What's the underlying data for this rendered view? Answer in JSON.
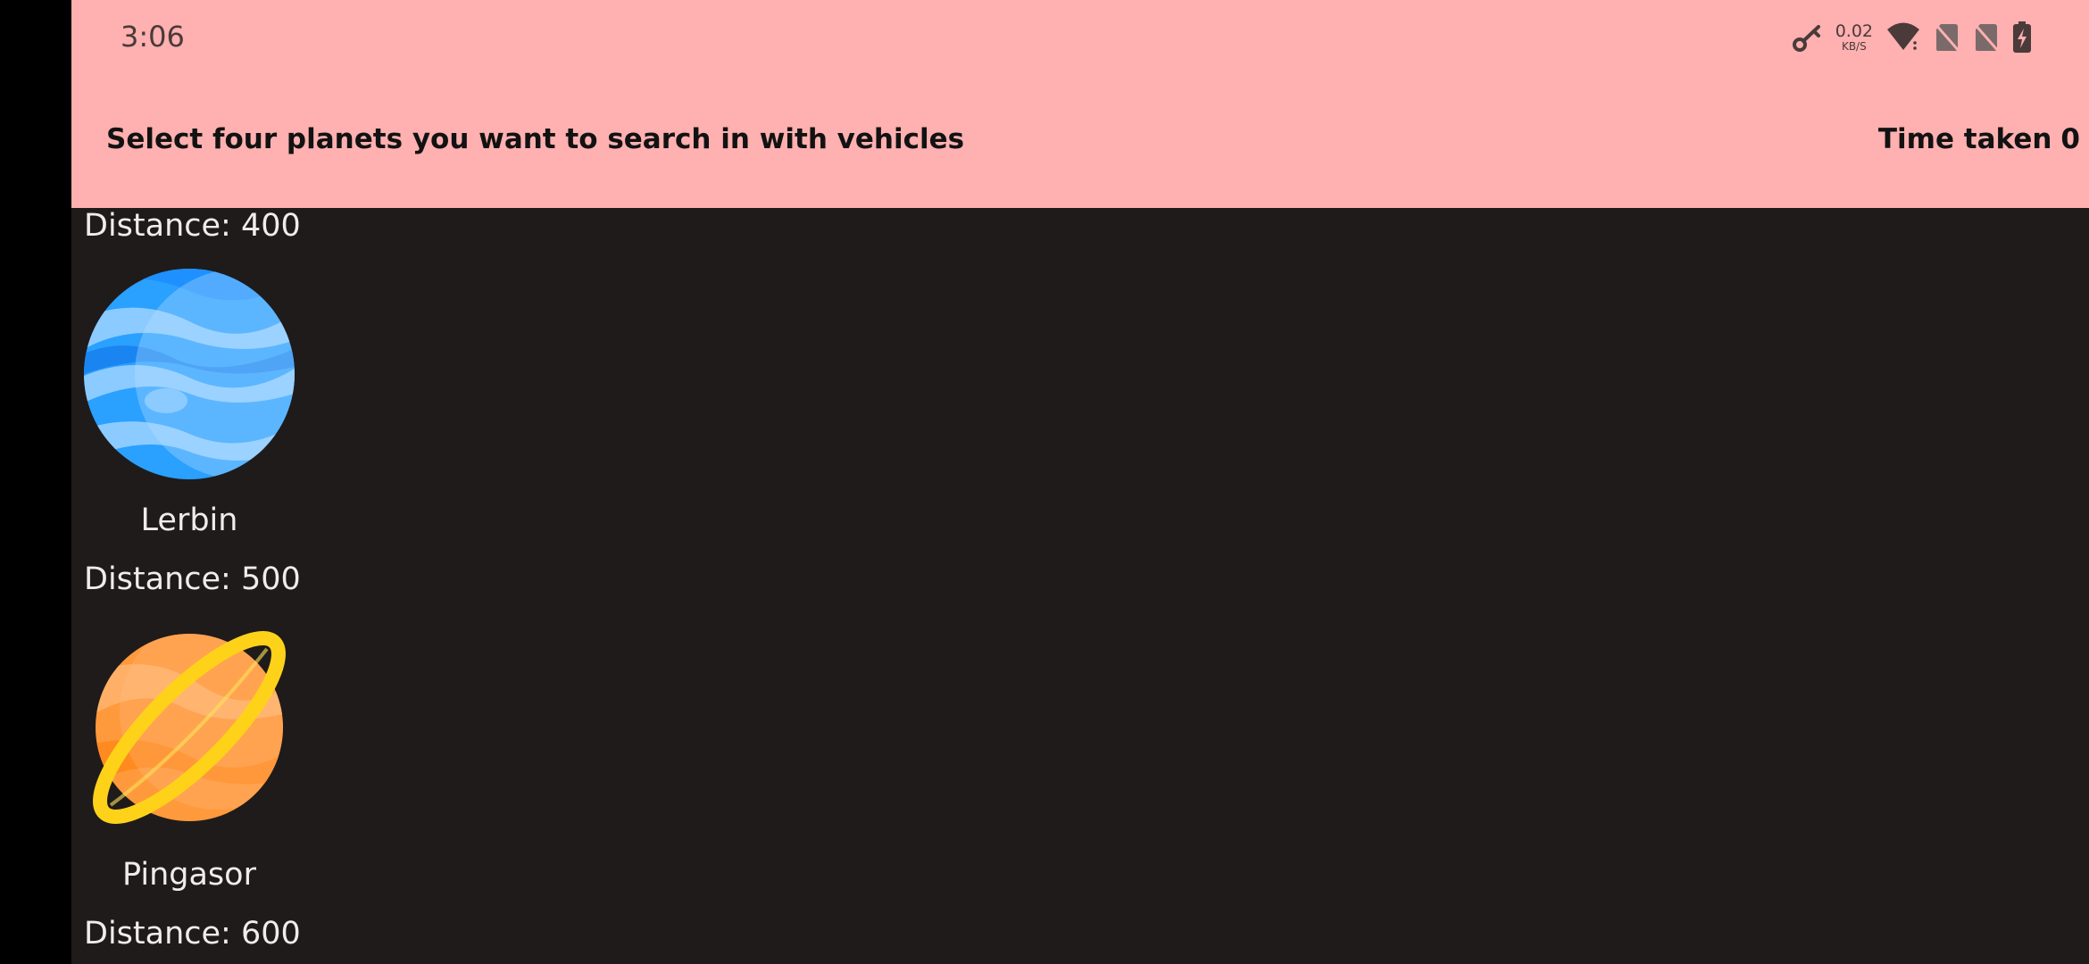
{
  "status_bar": {
    "time": "3:06",
    "net_speed_value": "0.02",
    "net_speed_unit": "KB/S",
    "icons": [
      "key-icon",
      "wifi-icon",
      "no-sim-icon",
      "no-sim-icon",
      "battery-charging-icon"
    ]
  },
  "header": {
    "title": "Select four planets you want to search in with vehicles",
    "time_taken_label": "Time taken",
    "time_taken_value": "0"
  },
  "planets": [
    {
      "distance_label": "Distance: 400"
    },
    {
      "name": "Lerbin",
      "distance_label": "Distance: 500",
      "icon": "blue-planet-icon"
    },
    {
      "name": "Pingasor",
      "distance_label": "Distance: 600",
      "icon": "ringed-planet-icon"
    }
  ],
  "colors": {
    "header_bg": "#ffb0b0",
    "screen_bg": "#1f1b1b",
    "text_light": "#f1ecec",
    "text_dark": "#121212"
  }
}
